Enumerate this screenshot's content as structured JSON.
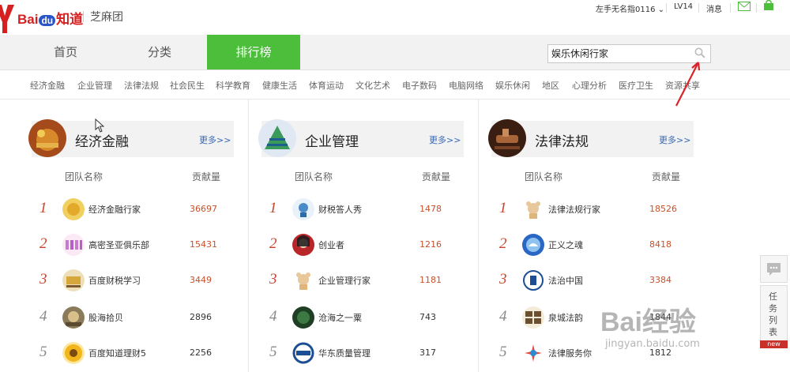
{
  "header": {
    "logo_bai": "Bai",
    "logo_du": "du",
    "logo_zhidao": "知道",
    "site_name": "芝麻团",
    "user_name": "左手无名指0116",
    "level": "LV14",
    "messages": "消息"
  },
  "nav": {
    "tabs": [
      "首页",
      "分类",
      "排行榜"
    ],
    "active_index": 2,
    "active_color": "#4cbe3b"
  },
  "search": {
    "value": "娱乐休闲行家"
  },
  "categories": [
    "经济金融",
    "企业管理",
    "法律法规",
    "社会民生",
    "科学教育",
    "健康生活",
    "体育运动",
    "文化艺术",
    "电子数码",
    "电脑网络",
    "娱乐休闲",
    "地区",
    "心理分析",
    "医疗卫生",
    "资源共享"
  ],
  "panels": [
    {
      "title": "经济金融",
      "more": "更多>>",
      "col_team": "团队名称",
      "col_contrib": "贡献量",
      "rows": [
        {
          "rank": "1",
          "name": "经济金融行家",
          "value": "36697"
        },
        {
          "rank": "2",
          "name": "高密圣亚俱乐部",
          "value": "15431"
        },
        {
          "rank": "3",
          "name": "百度财税学习",
          "value": "3449"
        },
        {
          "rank": "4",
          "name": "股海拾贝",
          "value": "2896"
        },
        {
          "rank": "5",
          "name": "百度知道理财5",
          "value": "2256"
        }
      ]
    },
    {
      "title": "企业管理",
      "more": "更多>>",
      "col_team": "团队名称",
      "col_contrib": "贡献量",
      "rows": [
        {
          "rank": "1",
          "name": "财税答人秀",
          "value": "1478"
        },
        {
          "rank": "2",
          "name": "创业者",
          "value": "1216"
        },
        {
          "rank": "3",
          "name": "企业管理行家",
          "value": "1181"
        },
        {
          "rank": "4",
          "name": "沧海之一粟",
          "value": "743"
        },
        {
          "rank": "5",
          "name": "华东质量管理",
          "value": "317"
        }
      ]
    },
    {
      "title": "法律法规",
      "more": "更多>>",
      "col_team": "团队名称",
      "col_contrib": "贡献量",
      "rows": [
        {
          "rank": "1",
          "name": "法律法规行家",
          "value": "18526"
        },
        {
          "rank": "2",
          "name": "正义之魂",
          "value": "8418"
        },
        {
          "rank": "3",
          "name": "法治中国",
          "value": "3384"
        },
        {
          "rank": "4",
          "name": "泉城法韵",
          "value": "1844"
        },
        {
          "rank": "5",
          "name": "法律服务你",
          "value": "1812"
        }
      ]
    }
  ],
  "sidebar": {
    "task_label": "任务列表",
    "new_badge": "new"
  },
  "watermark": {
    "brand": "Bai经验",
    "url": "jingyan.baidu.com"
  },
  "colors": {
    "rank_top": "#c8432b",
    "value_hot": "#c8502a",
    "more_link": "#3868b3"
  }
}
